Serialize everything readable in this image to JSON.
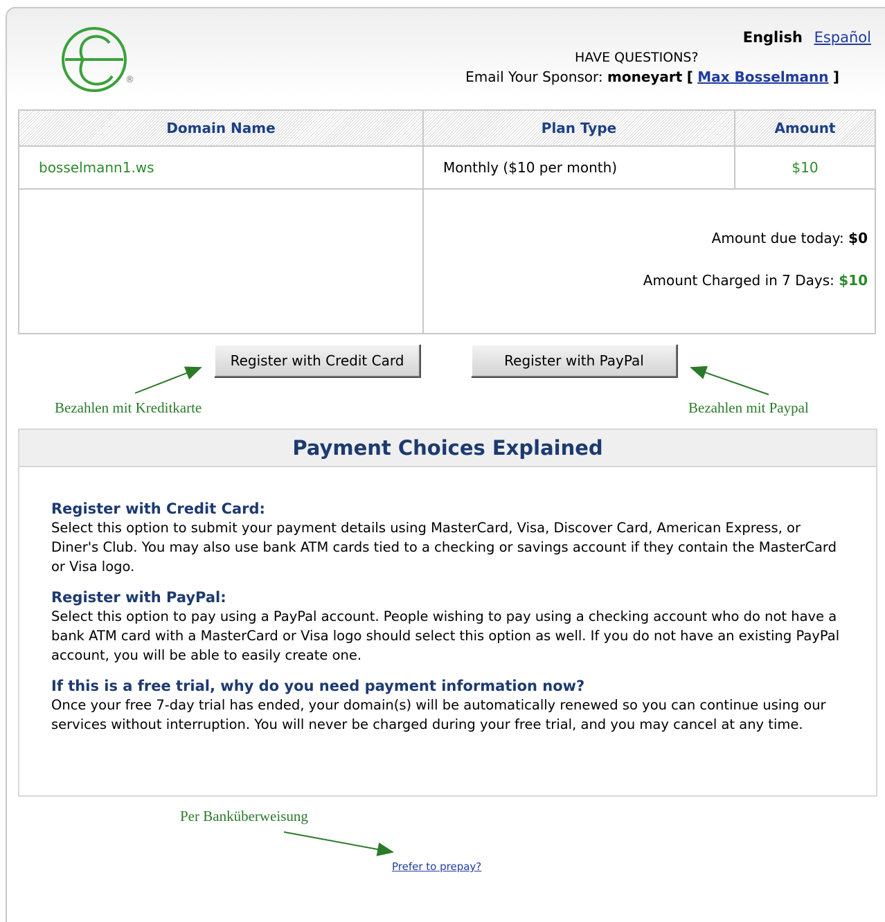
{
  "header": {
    "lang_current": "English",
    "lang_alt": "Español",
    "questions": "HAVE QUESTIONS?",
    "sponsor_prefix": "Email Your Sponsor:",
    "sponsor_id": "moneyart",
    "bracket_open": "[",
    "sponsor_name": "Max Bosselmann",
    "bracket_close": "]",
    "registered_mark": "®"
  },
  "table": {
    "headers": [
      "Domain Name",
      "Plan Type",
      "Amount"
    ],
    "rows": [
      {
        "domain": "bosselmann1.ws",
        "plan": "Monthly ($10 per month)",
        "amount": "$10"
      }
    ],
    "due_today_label": "Amount due today:",
    "due_today_value": "$0",
    "charged_label": "Amount Charged in 7 Days:",
    "charged_value": "$10"
  },
  "buttons": {
    "credit_card": "Register with Credit Card",
    "paypal": "Register with PayPal"
  },
  "annotations": {
    "credit_card": "Bezahlen mit Kreditkarte",
    "paypal": "Bezahlen mit Paypal",
    "bank": "Per Banküberweisung"
  },
  "explain": {
    "title": "Payment Choices Explained",
    "items": [
      {
        "q": "Register with Credit Card:",
        "a": "Select this option to submit your payment details using MasterCard, Visa, Discover Card, American Express, or Diner's Club. You may also use bank ATM cards tied to a checking or savings account if they contain the MasterCard or Visa logo."
      },
      {
        "q": "Register with PayPal:",
        "a": "Select this option to pay using a PayPal account. People wishing to pay using a checking account who do not have a bank ATM card with a MasterCard or Visa logo should select this option as well. If you do not have an existing PayPal account, you will be able to easily create one."
      },
      {
        "q": "If this is a free trial, why do you need payment information now?",
        "a": "Once your free 7-day trial has ended, your domain(s) will be automatically renewed so you can continue using our services without interruption. You will never be charged during your free trial, and you may cancel at any time."
      }
    ]
  },
  "prepay_link": "Prefer to prepay?",
  "colors": {
    "brand_green": "#2c8a2c",
    "heading_blue": "#1d3a70",
    "link_blue": "#1f3b9e",
    "annotation_green": "#2a7a2a"
  },
  "icons": {
    "logo": "e-globe-logo-icon",
    "arrow": "arrow-icon"
  }
}
